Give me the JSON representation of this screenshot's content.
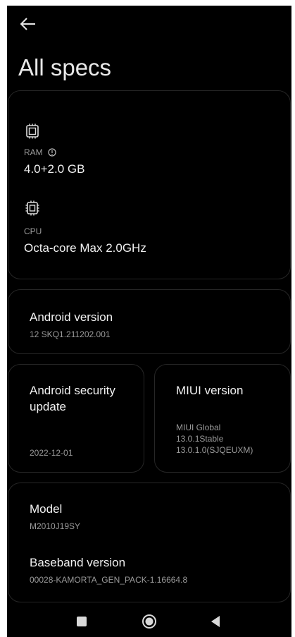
{
  "header": {
    "back_icon": "back-arrow-icon",
    "title": "All specs"
  },
  "hardware": {
    "ram": {
      "icon": "memory-chip-icon",
      "label": "RAM",
      "info_icon": "info-icon",
      "value": "4.0+2.0 GB"
    },
    "cpu": {
      "icon": "processor-chip-icon",
      "label": "CPU",
      "value": "Octa-core Max 2.0GHz"
    }
  },
  "android_version": {
    "title": "Android version",
    "value": "12 SKQ1.211202.001"
  },
  "security_update": {
    "title_line1": "Android security",
    "title_line2": "update",
    "value": "2022-12-01"
  },
  "miui_version": {
    "title": "MIUI version",
    "value_line1": "MIUI Global",
    "value_line2": "13.0.1Stable",
    "value_line3": "13.0.1.0(SJQEUXM)"
  },
  "device": {
    "model_title": "Model",
    "model_value": "M2010J19SY",
    "baseband_title": "Baseband version",
    "baseband_value": "00028-KAMORTA_GEN_PACK-1.16664.8"
  },
  "nav_bar": {
    "recents_icon": "square-recents-icon",
    "home_icon": "circle-home-icon",
    "back_icon": "triangle-back-icon"
  },
  "colors": {
    "background": "#000000",
    "card_border": "#262626",
    "primary_text": "#f0f0f0",
    "secondary_text": "#9a9a9a"
  }
}
